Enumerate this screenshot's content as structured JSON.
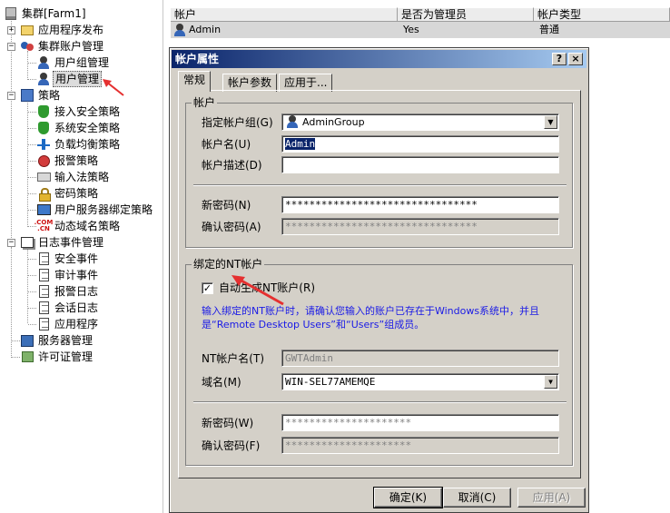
{
  "tree": {
    "items": [
      {
        "label": "集群[Farm1]",
        "icon": "server-icon"
      },
      {
        "label": "应用程序发布",
        "icon": "folder-icon"
      },
      {
        "label": "集群账户管理",
        "icon": "users-icon"
      },
      {
        "label": "用户组管理",
        "icon": "user-group-icon"
      },
      {
        "label": "用户管理",
        "icon": "user-icon"
      },
      {
        "label": "策略",
        "icon": "policy-icon"
      },
      {
        "label": "接入安全策略",
        "icon": "shield-icon"
      },
      {
        "label": "系统安全策略",
        "icon": "shield-icon"
      },
      {
        "label": "负载均衡策略",
        "icon": "network-icon"
      },
      {
        "label": "报警策略",
        "icon": "alarm-icon"
      },
      {
        "label": "输入法策略",
        "icon": "keyboard-icon"
      },
      {
        "label": "密码策略",
        "icon": "lock-icon"
      },
      {
        "label": "用户服务器绑定策略",
        "icon": "monitor-icon"
      },
      {
        "label": "动态域名策略",
        "icon": "com-icon"
      },
      {
        "label": "日志事件管理",
        "icon": "log-icon"
      },
      {
        "label": "安全事件",
        "icon": "page-icon"
      },
      {
        "label": "审计事件",
        "icon": "page-icon"
      },
      {
        "label": "报警日志",
        "icon": "page-icon"
      },
      {
        "label": "会话日志",
        "icon": "page-icon"
      },
      {
        "label": "应用程序",
        "icon": "page-icon"
      },
      {
        "label": "服务器管理",
        "icon": "server-manager-icon"
      },
      {
        "label": "许可证管理",
        "icon": "license-icon"
      }
    ]
  },
  "list": {
    "columns": [
      "帐户",
      "是否为管理员",
      "帐户类型"
    ],
    "rows": [
      {
        "account": "Admin",
        "is_admin": "Yes",
        "type": "普通"
      }
    ]
  },
  "dialog": {
    "title": "帐户属性",
    "help_button": "?",
    "close_button": "×",
    "tabs": [
      "常规",
      "帐户参数",
      "应用于..."
    ],
    "account_group": {
      "title": "帐户",
      "usergroup_label": "指定帐户组(G)",
      "usergroup_value": "AdminGroup",
      "username_label": "帐户名(U)",
      "username_value": "Admin",
      "desc_label": "帐户描述(D)",
      "desc_value": "",
      "newpw_label": "新密码(N)",
      "newpw_value": "********************************",
      "confirmpw_label": "确认密码(A)",
      "confirmpw_value": "********************************"
    },
    "nt_group": {
      "title": "绑定的NT帐户",
      "autogen_label": "自动生成NT账户(R)",
      "autogen_checked": "✓",
      "note_line1": "输入绑定的NT账户时，请确认您输入的账户已存在于Windows系统中，并且",
      "note_line2": "是“Remote Desktop Users”和“Users”组成员。",
      "ntname_label": "NT帐户名(T)",
      "ntname_value": "GWTAdmin",
      "domain_label": "域名(M)",
      "domain_value": "WIN-SEL77AMEMQE",
      "newpw_label": "新密码(W)",
      "newpw_value": "*********************",
      "confirmpw_label": "确认密码(F)",
      "confirmpw_value": "*********************"
    },
    "buttons": {
      "ok": "确定(K)",
      "cancel": "取消(C)",
      "apply": "应用(A)"
    }
  },
  "colors": {
    "title_gradient_start": "#0a246a",
    "title_gradient_end": "#a6caf0",
    "dialog_face": "#d4d0c8",
    "note_text": "#1a1ae6",
    "annotation_arrow": "#e53030"
  }
}
